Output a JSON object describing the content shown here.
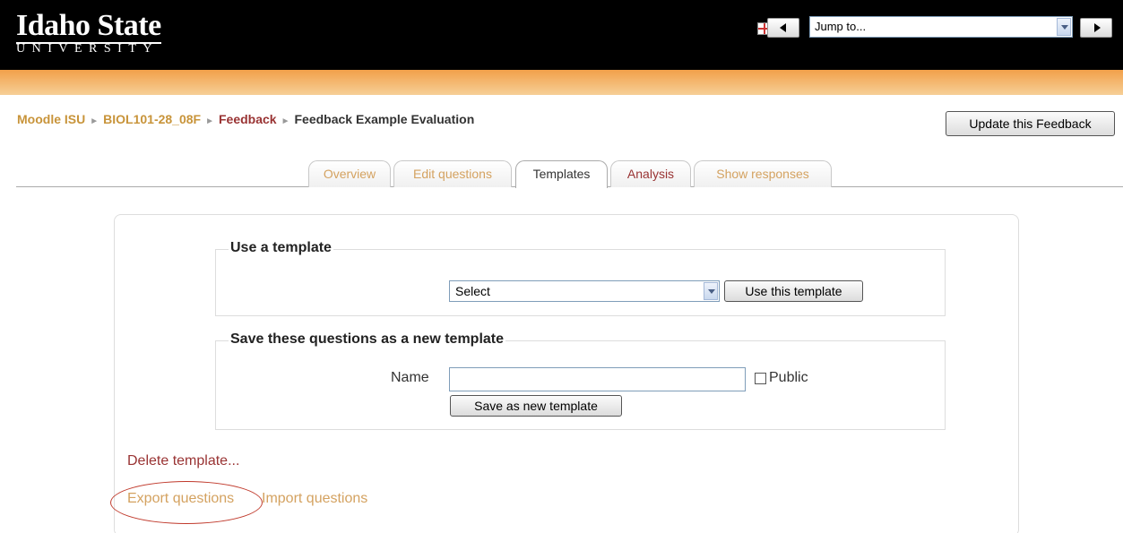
{
  "header": {
    "logo_top": "Idaho State",
    "logo_bottom": "UNIVERSITY",
    "jump_to": "Jump to..."
  },
  "breadcrumb": {
    "home": "Moodle ISU",
    "course": "BIOL101-28_08F",
    "module": "Feedback",
    "current": "Feedback Example Evaluation"
  },
  "update_button": "Update this Feedback",
  "tabs": [
    {
      "label": "Overview"
    },
    {
      "label": "Edit questions"
    },
    {
      "label": "Templates"
    },
    {
      "label": "Analysis"
    },
    {
      "label": "Show responses"
    }
  ],
  "use_template": {
    "legend": "Use a template",
    "select_value": "Select",
    "button": "Use this template"
  },
  "save_template": {
    "legend": "Save these questions as a new template",
    "name_label": "Name",
    "name_value": "",
    "public_label": "Public",
    "button": "Save as new template"
  },
  "links": {
    "delete": "Delete template...",
    "export": "Export questions",
    "import": "Import questions"
  },
  "colors": {
    "accent_gold": "#d4a260",
    "link_red": "#993333",
    "annotation_red": "#c0392b"
  }
}
